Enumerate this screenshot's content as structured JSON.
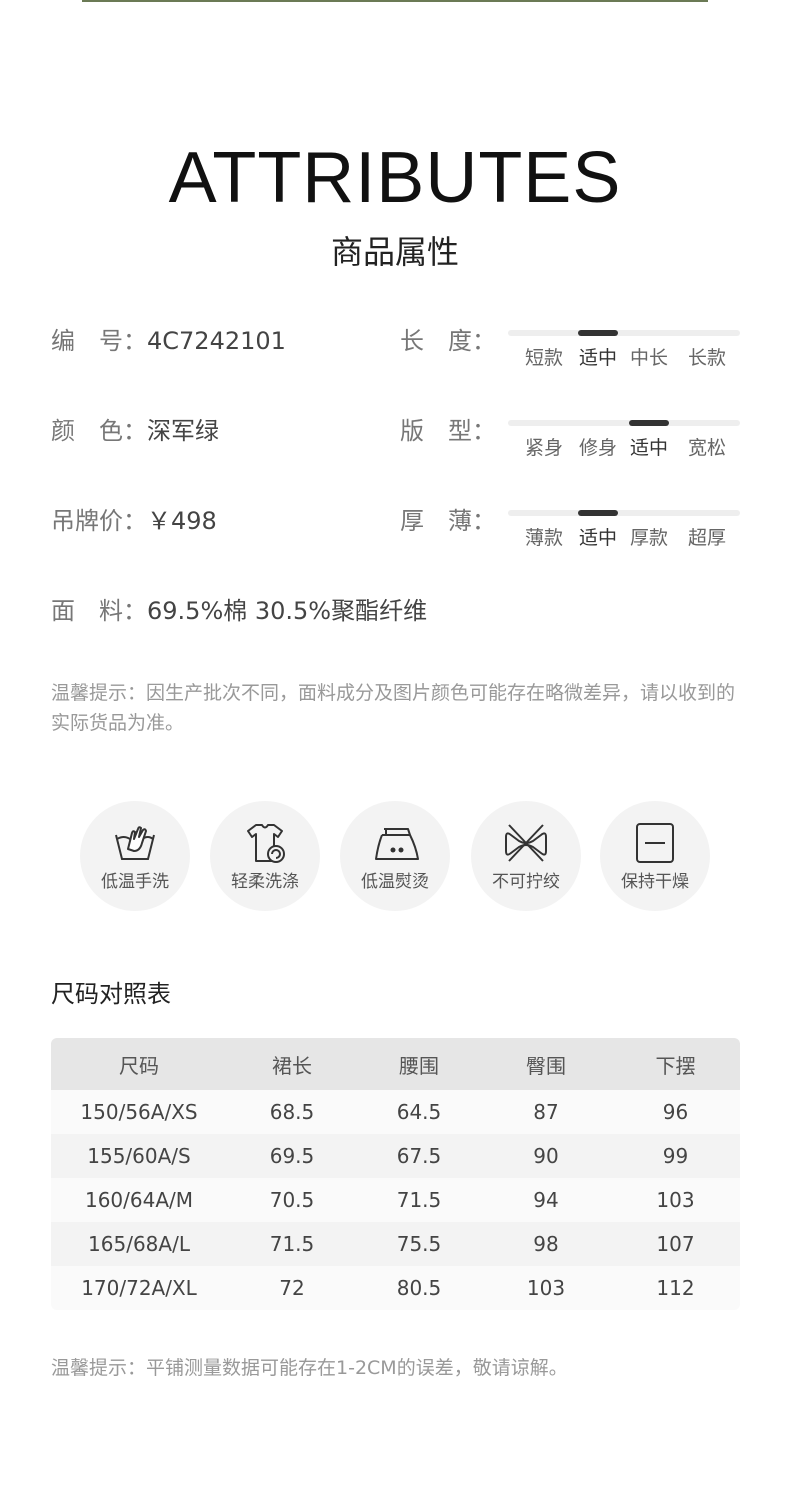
{
  "header": {
    "title_en": "ATTRIBUTES",
    "title_cn": "商品属性"
  },
  "attributes": {
    "code": {
      "label": "编　号：",
      "value": "4C7242101"
    },
    "color": {
      "label": "颜　色：",
      "value": "深军绿"
    },
    "price": {
      "label": "吊牌价：",
      "value": "￥498"
    },
    "fabric": {
      "label": "面　料：",
      "value": "69.5%棉 30.5%聚酯纤维"
    }
  },
  "scales": {
    "length": {
      "label": "长　度：",
      "options": [
        "短款",
        "适中",
        "中长",
        "长款"
      ],
      "selected": 1
    },
    "fit": {
      "label": "版　型：",
      "options": [
        "紧身",
        "修身",
        "适中",
        "宽松"
      ],
      "selected": 2
    },
    "thickness": {
      "label": "厚　薄：",
      "options": [
        "薄款",
        "适中",
        "厚款",
        "超厚"
      ],
      "selected": 1
    }
  },
  "notice1": "温馨提示：因生产批次不同，面料成分及图片颜色可能存在略微差异，请以收到的实际货品为准。",
  "care": [
    {
      "icon": "hand-wash-icon",
      "label": "低温手洗"
    },
    {
      "icon": "gentle-wash-icon",
      "label": "轻柔洗涤"
    },
    {
      "icon": "low-iron-icon",
      "label": "低温熨烫"
    },
    {
      "icon": "no-wring-icon",
      "label": "不可拧绞"
    },
    {
      "icon": "flat-dry-icon",
      "label": "保持干燥"
    }
  ],
  "size_chart": {
    "title": "尺码对照表",
    "headers": [
      "尺码",
      "裙长",
      "腰围",
      "臀围",
      "下摆"
    ],
    "rows": [
      [
        "150/56A/XS",
        "68.5",
        "64.5",
        "87",
        "96"
      ],
      [
        "155/60A/S",
        "69.5",
        "67.5",
        "90",
        "99"
      ],
      [
        "160/64A/M",
        "70.5",
        "71.5",
        "94",
        "103"
      ],
      [
        "165/68A/L",
        "71.5",
        "75.5",
        "98",
        "107"
      ],
      [
        "170/72A/XL",
        "72",
        "80.5",
        "103",
        "112"
      ]
    ]
  },
  "notice2": "温馨提示：平铺测量数据可能存在1-2CM的误差，敬请谅解。"
}
